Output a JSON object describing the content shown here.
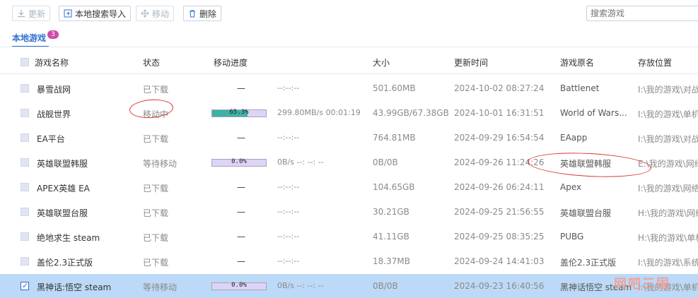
{
  "toolbar": {
    "refresh_label": "更新",
    "import_label": "本地搜索导入",
    "move_label": "移动",
    "delete_label": "删除",
    "search_placeholder": "搜索游戏"
  },
  "tab": {
    "label": "本地游戏",
    "badge": "3"
  },
  "columns": [
    "游戏名称",
    "状态",
    "移动进度",
    "大小",
    "更新时间",
    "游戏原名",
    "存放位置"
  ],
  "rows": [
    {
      "name": "暴雪战网",
      "status": "已下载",
      "progress": null,
      "speed": "--:--:--",
      "size": "501.60MB",
      "time": "2024-10-02 08:27:24",
      "orig": "Battlenet",
      "loc": "I:\\我的游戏\\对战"
    },
    {
      "name": "战舰世界",
      "status": "移动中",
      "progress": 0.653,
      "progress_text": "65.3%",
      "speed": "299.80MB/s 00:01:19",
      "size": "43.99GB/67.38GB",
      "time": "2024-10-01 16:31:51",
      "orig": "World of Wars...",
      "loc": "I:\\我的游戏\\单机"
    },
    {
      "name": "EA平台",
      "status": "已下载",
      "progress": null,
      "speed": "--:--:--",
      "size": "764.81MB",
      "time": "2024-09-29 16:54:54",
      "orig": "EAapp",
      "loc": "I:\\我的游戏\\对战"
    },
    {
      "name": "英雄联盟韩服",
      "status": "等待移动",
      "progress": 0.0,
      "progress_text": "0.0%",
      "speed": "0B/s --: --: --",
      "size": "0B/0B",
      "time": "2024-09-26 11:24:26",
      "orig": "英雄联盟韩服",
      "loc": "E:\\我的游戏\\网络"
    },
    {
      "name": "APEX英雄 EA",
      "status": "已下载",
      "progress": null,
      "speed": "--:--:--",
      "size": "104.65GB",
      "time": "2024-09-26 06:24:11",
      "orig": "Apex",
      "loc": "I:\\我的游戏\\网络"
    },
    {
      "name": "英雄联盟台服",
      "status": "已下载",
      "progress": null,
      "speed": "--:--:--",
      "size": "30.21GB",
      "time": "2024-09-25 21:56:55",
      "orig": "英雄联盟台服",
      "loc": "H:\\我的游戏\\网络"
    },
    {
      "name": "绝地求生 steam",
      "status": "已下载",
      "progress": null,
      "speed": "--:--:--",
      "size": "41.11GB",
      "time": "2024-09-25 08:35:25",
      "orig": "PUBG",
      "loc": "H:\\我的游戏\\单机"
    },
    {
      "name": "盖伦2.3正式版",
      "status": "已下载",
      "progress": null,
      "speed": "--:--:--",
      "size": "18.37MB",
      "time": "2024-09-24 14:41:03",
      "orig": "盖伦2.3正式版",
      "loc": "I:\\我的游戏\\系统"
    },
    {
      "name": "黑神话:悟空 steam",
      "status": "等待移动",
      "progress": 0.0,
      "progress_text": "0.0%",
      "speed": "0B/s --: --: --",
      "size": "0B/0B",
      "time": "2024-09-23 16:40:56",
      "orig": "黑神话悟空 steam",
      "loc": "I:\\我的游戏\\单机",
      "selected": true
    }
  ],
  "watermark": "网吧三国",
  "colors": {
    "accent": "#2e6fd0",
    "progress_fill": "#3db2a2",
    "selected_row": "#bcd9f7",
    "annotation": "#d9382f"
  }
}
